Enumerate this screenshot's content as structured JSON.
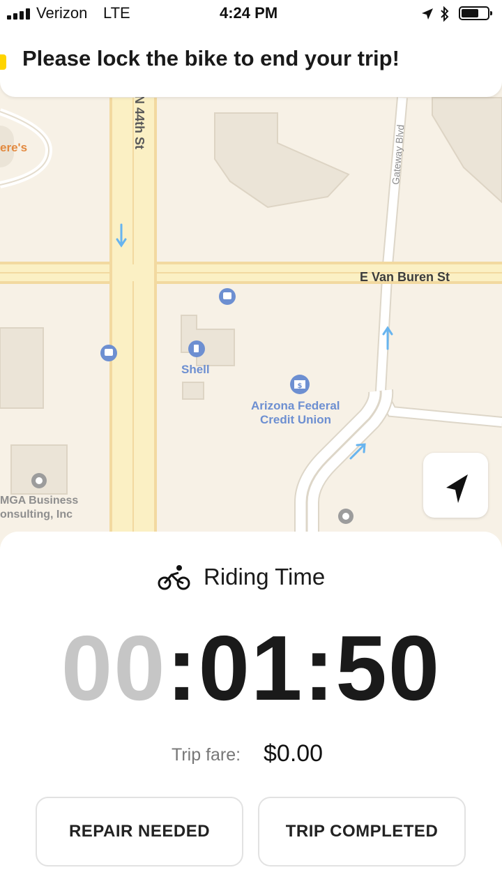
{
  "status_bar": {
    "carrier": "Verizon",
    "network": "LTE",
    "time": "4:24 PM"
  },
  "banner": {
    "message": "Please lock the bike to end your trip!"
  },
  "map": {
    "street_n44th": "N 44th St",
    "street_van_buren": "E Van Buren St",
    "street_gateway": "Gateway Blvd",
    "poi_left_partial": "ere's",
    "poi_shell": "Shell",
    "poi_credit_union_line1": "Arizona Federal",
    "poi_credit_union_line2": "Credit Union",
    "poi_mga_line1": "MGA Business",
    "poi_mga_line2": "onsulting, Inc"
  },
  "ride": {
    "title": "Riding Time",
    "timer_hours": "00",
    "timer_sep1": ":",
    "timer_minutes": "01",
    "timer_sep2": ":",
    "timer_seconds": "50",
    "fare_label": "Trip fare:",
    "fare_value": "$0.00"
  },
  "actions": {
    "repair_label": "REPAIR NEEDED",
    "complete_label": "TRIP COMPLETED"
  },
  "colors": {
    "banner_accent": "#ffd400",
    "map_background": "#f7f1e6",
    "road_fill": "#fbf0c4",
    "road_edge": "#f2d9a0",
    "poi_blue": "#6d8fd1",
    "poi_orange": "#e2893f"
  }
}
